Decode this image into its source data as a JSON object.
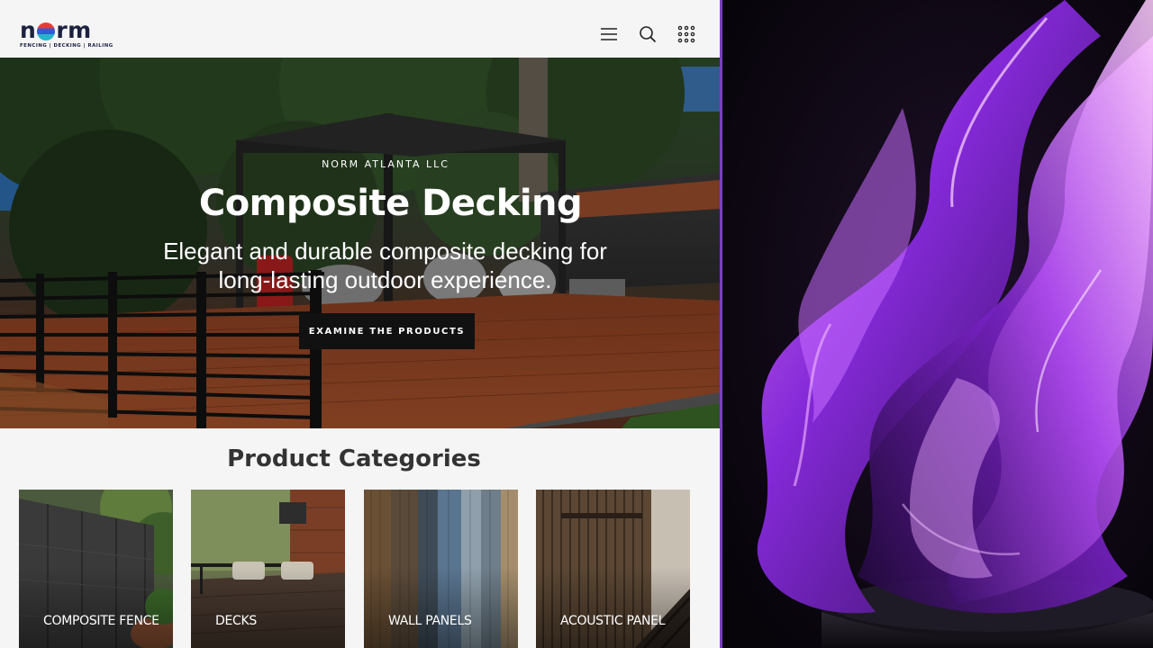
{
  "brand": {
    "logo_text_left": "n",
    "logo_text_right": "rm",
    "tagline": "FENCING | DECKING | RAILING"
  },
  "header": {
    "icons": [
      "menu-icon",
      "search-icon",
      "apps-grid-icon"
    ]
  },
  "hero": {
    "eyebrow": "NORM ATLANTA LLC",
    "title": "Composite Decking",
    "subtitle": "Elegant and durable composite decking for long-lasting outdoor experience.",
    "cta_label": "EXAMINE THE PRODUCTS"
  },
  "categories": {
    "heading": "Product Categories",
    "items": [
      {
        "label": "COMPOSITE FENCE"
      },
      {
        "label": "DECKS"
      },
      {
        "label": "WALL PANELS"
      },
      {
        "label": "ACOUSTIC PANEL"
      }
    ]
  },
  "colors": {
    "accent_divider": "#7b3fc4",
    "logo_navy": "#1c2140",
    "cta_background": "#111111"
  }
}
